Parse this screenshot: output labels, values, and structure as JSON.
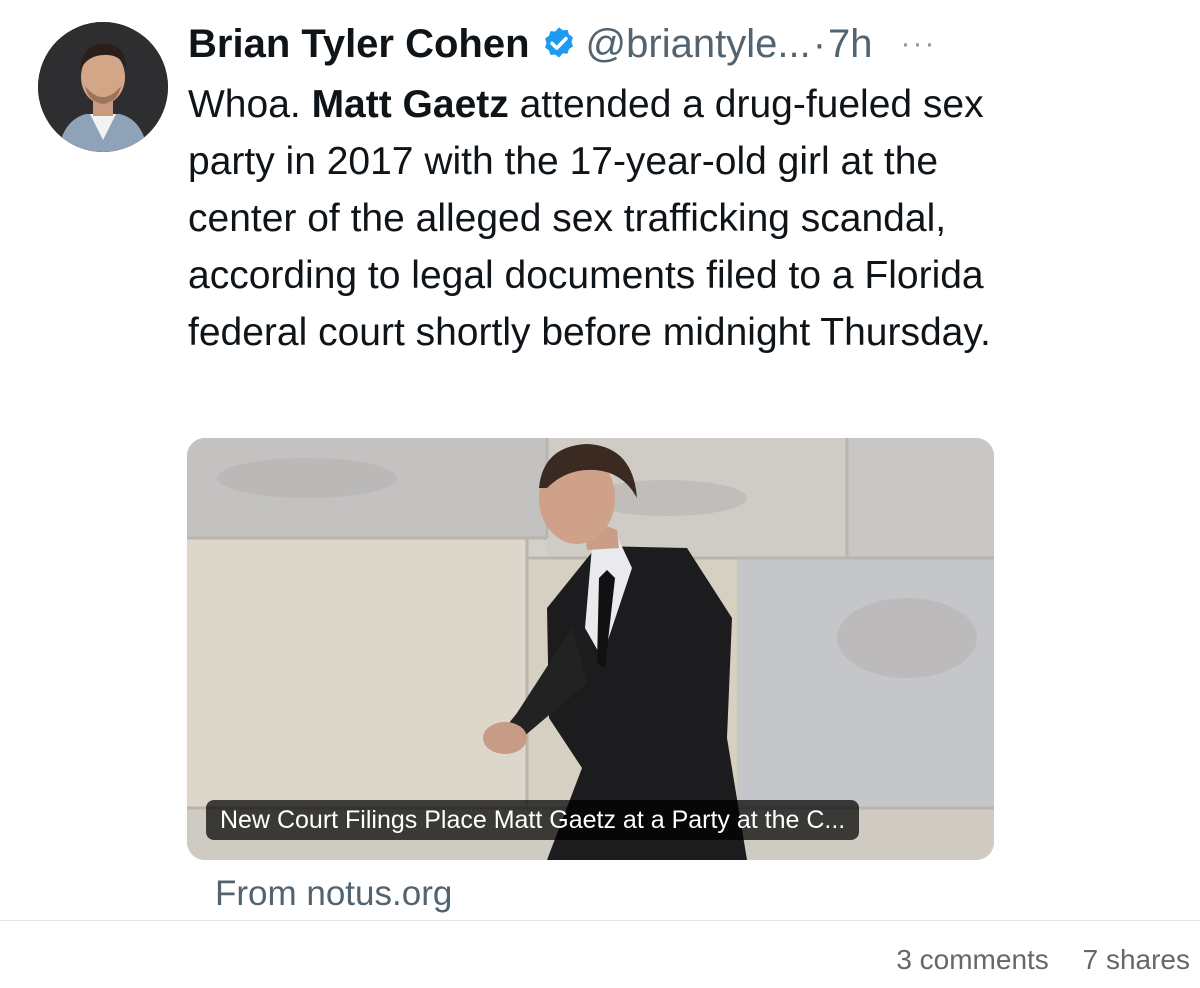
{
  "tweet": {
    "author": {
      "display_name": "Brian Tyler Cohen",
      "handle": "@briantyle...",
      "verified": true,
      "avatar_icon": "profile-photo"
    },
    "separator": "·",
    "time": "7h",
    "more_icon": "ellipsis-icon",
    "more_label": "···",
    "text": {
      "intro": "Whoa. ",
      "bold": "Matt Gaetz",
      "rest": " attended a drug-fueled sex party in 2017 with the 17-year-old girl at the center of the alleged sex trafficking scandal, according to legal documents filed to a Florida federal court shortly before midnight Thursday."
    },
    "link_card": {
      "caption": "New Court Filings Place Matt Gaetz at a Party at the C...",
      "source": "From notus.org"
    }
  },
  "post_footer": {
    "comments": "3 comments",
    "shares": "7 shares"
  },
  "colors": {
    "text_primary": "#0f1419",
    "text_secondary": "#536471",
    "verified_blue": "#1d9bf0"
  }
}
